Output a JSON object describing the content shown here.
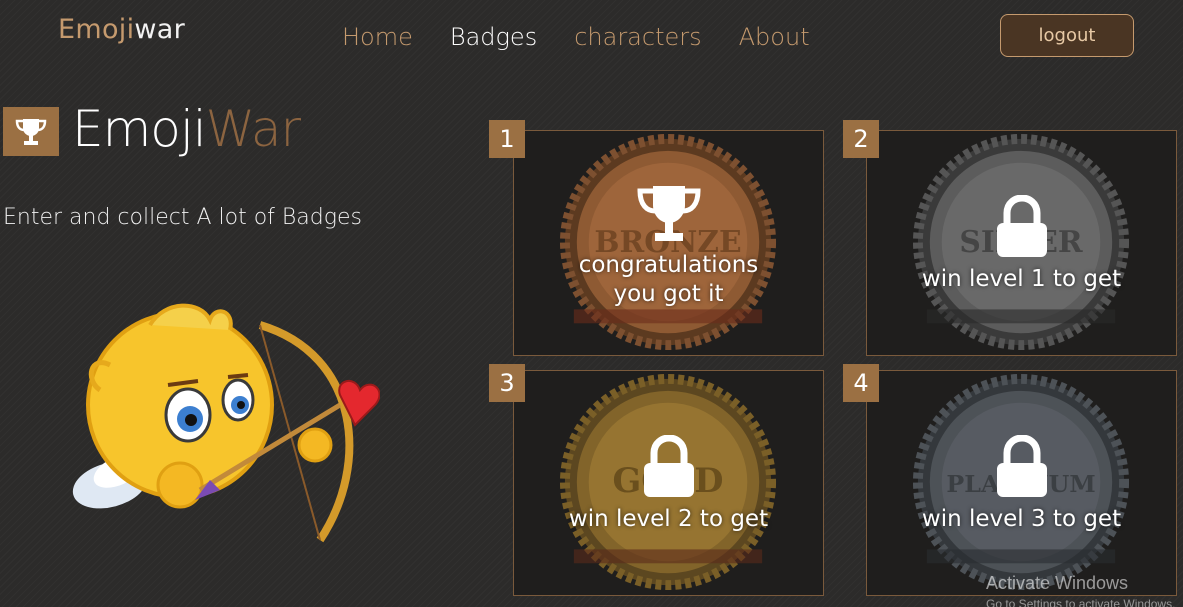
{
  "header": {
    "brand_part1": "Emoji",
    "brand_part2": "war",
    "nav": [
      "Home",
      "Badges",
      "characters",
      "About"
    ],
    "active_nav": "Badges",
    "logout_label": "logout"
  },
  "hero": {
    "title_part1": "Emoji",
    "title_part2": "War",
    "tagline": "Enter and collect A lot of Badges"
  },
  "badges": [
    {
      "number": "1",
      "medal_text": "BRONZE",
      "status_line1": "congratulations",
      "status_line2": "you got it",
      "icon": "trophy-icon",
      "unlocked": true,
      "medal_color": "#a56a3e"
    },
    {
      "number": "2",
      "medal_text": "SILVER",
      "status_line1": "win level 1 to get",
      "status_line2": "",
      "icon": "lock-icon",
      "unlocked": false,
      "medal_color": "#6f6f6f"
    },
    {
      "number": "3",
      "medal_text": "GOLD",
      "status_line1": "win level 2 to get",
      "status_line2": "",
      "icon": "lock-icon",
      "unlocked": false,
      "medal_color": "#9e7a34"
    },
    {
      "number": "4",
      "medal_text": "PLATINUM",
      "status_line1": "win level 3 to get",
      "status_line2": "",
      "icon": "lock-icon",
      "unlocked": false,
      "medal_color": "#5b6066"
    }
  ],
  "watermark": {
    "title": "Activate Windows",
    "subtitle": "Go to Settings to activate Windows."
  },
  "colors": {
    "accent": "#c59a6e",
    "accent_dark": "#9b7043",
    "background": "#2c2b2a"
  }
}
